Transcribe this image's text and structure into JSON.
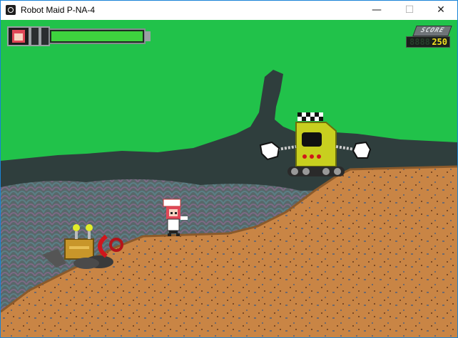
{
  "window": {
    "title": "Robot Maid P-NA-4",
    "controls": {
      "minimize": "—",
      "maximize": "☐",
      "close": "✕"
    }
  },
  "hud": {
    "health_fraction": 1.0,
    "score_label": "SCORE",
    "score_ghost": "8888",
    "score_value": "250"
  },
  "colors": {
    "sky": "#21c24a",
    "hills": "#2f3e3d",
    "dirt": "#c98545",
    "grass_edge": "#8b5a2b",
    "health": "#3ed33e",
    "score_digits": "#f1e11f"
  }
}
